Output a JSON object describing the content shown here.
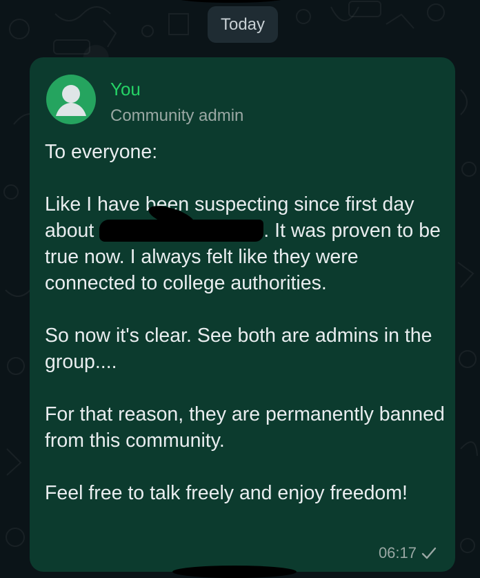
{
  "date_chip": {
    "label": "Today"
  },
  "message": {
    "sender_name": "You",
    "sender_role": "Community admin",
    "paragraphs": {
      "p1": "To everyone:",
      "p2_part1": "Like I have been suspecting since first day about ",
      "p2_part2": ". It was proven to be true now. I always felt like they were connected to college authorities.",
      "p3": "So now it's clear. See both are admins in the group....",
      "p4": "For that reason, they are permanently banned from this community.",
      "p5": "Feel free to talk freely and enjoy freedom!"
    },
    "time": "06:17",
    "status_icon": "single-check-icon"
  },
  "colors": {
    "background": "#0b1418",
    "bubble": "#0c3b2e",
    "sender_name": "#25d366",
    "avatar": "#25a45f",
    "date_chip": "#1f2c33",
    "text": "#e9edef",
    "meta": "#9aa8a4"
  }
}
